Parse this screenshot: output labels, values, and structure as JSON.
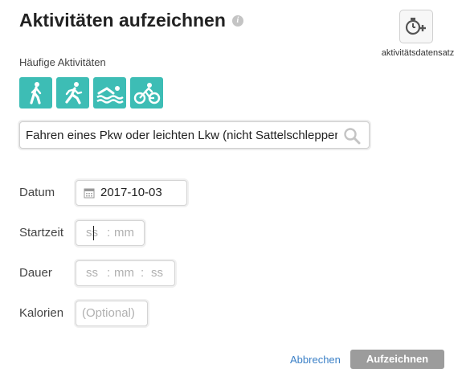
{
  "header": {
    "title": "Aktivitäten aufzeichnen",
    "info_icon": "info-icon"
  },
  "dataset": {
    "label": "aktivitätsdatensatz",
    "icon": "stopwatch-plus-icon"
  },
  "frequent": {
    "label": "Häufige Aktivitäten",
    "accent_color": "#3dbdb5",
    "activities": [
      {
        "icon": "walking-icon"
      },
      {
        "icon": "running-icon"
      },
      {
        "icon": "swimming-icon"
      },
      {
        "icon": "cycling-icon"
      }
    ]
  },
  "search": {
    "value": "Fahren eines Pkw oder leichten Lkw (nicht Sattelschlepper)",
    "icon": "search-icon"
  },
  "form": {
    "date_label": "Datum",
    "date_value": "2017-10-03",
    "start_label": "Startzeit",
    "start_hh": "ss",
    "start_mm": "mm",
    "duration_label": "Dauer",
    "duration_hh": "ss",
    "duration_mm": "mm",
    "duration_ss": "ss",
    "calories_label": "Kalorien",
    "calories_placeholder": "(Optional)"
  },
  "actions": {
    "cancel": "Abbrechen",
    "submit": "Aufzeichnen"
  }
}
